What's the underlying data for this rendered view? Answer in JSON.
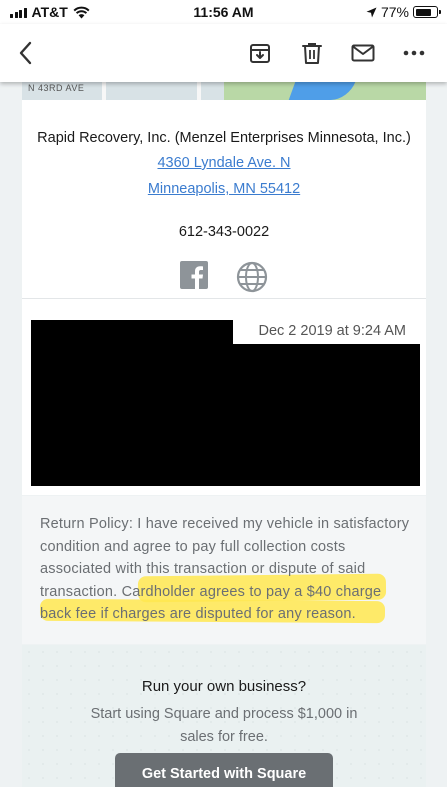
{
  "status_bar": {
    "carrier": "AT&T",
    "time": "11:56 AM",
    "battery_text": "77%",
    "battery_level": 0.77
  },
  "toolbar": {
    "icons": [
      "back-chevron-icon",
      "archive-icon",
      "trash-icon",
      "mail-icon",
      "more-icon"
    ]
  },
  "map": {
    "street_label": "N 43RD AVE"
  },
  "merchant": {
    "name": "Rapid Recovery, Inc. (Menzel Enterprises Minnesota, Inc.)",
    "address_line1": "4360 Lyndale Ave. N",
    "address_line2": "Minneapolis, MN 55412",
    "phone": "612-343-0022",
    "social_icons": [
      "facebook-icon",
      "globe-icon"
    ]
  },
  "receipt": {
    "date": "Dec 2 2019 at 9:24 AM"
  },
  "policy": {
    "text": "Return Policy: I have received my vehicle in satisfactory condition and agree to pay full collection costs associated with this transaction or dispute of said transaction. Cardholder agrees to pay a $40 charge back fee if charges are disputed for any reason."
  },
  "promo": {
    "title": "Run your own business?",
    "body": "Start using Square and process $1,000 in sales for free.",
    "cta_label": "Get Started with Square"
  },
  "colors": {
    "link": "#3b7ccf",
    "highlight": "#ffe850",
    "cta_bg": "#6a6f73"
  }
}
